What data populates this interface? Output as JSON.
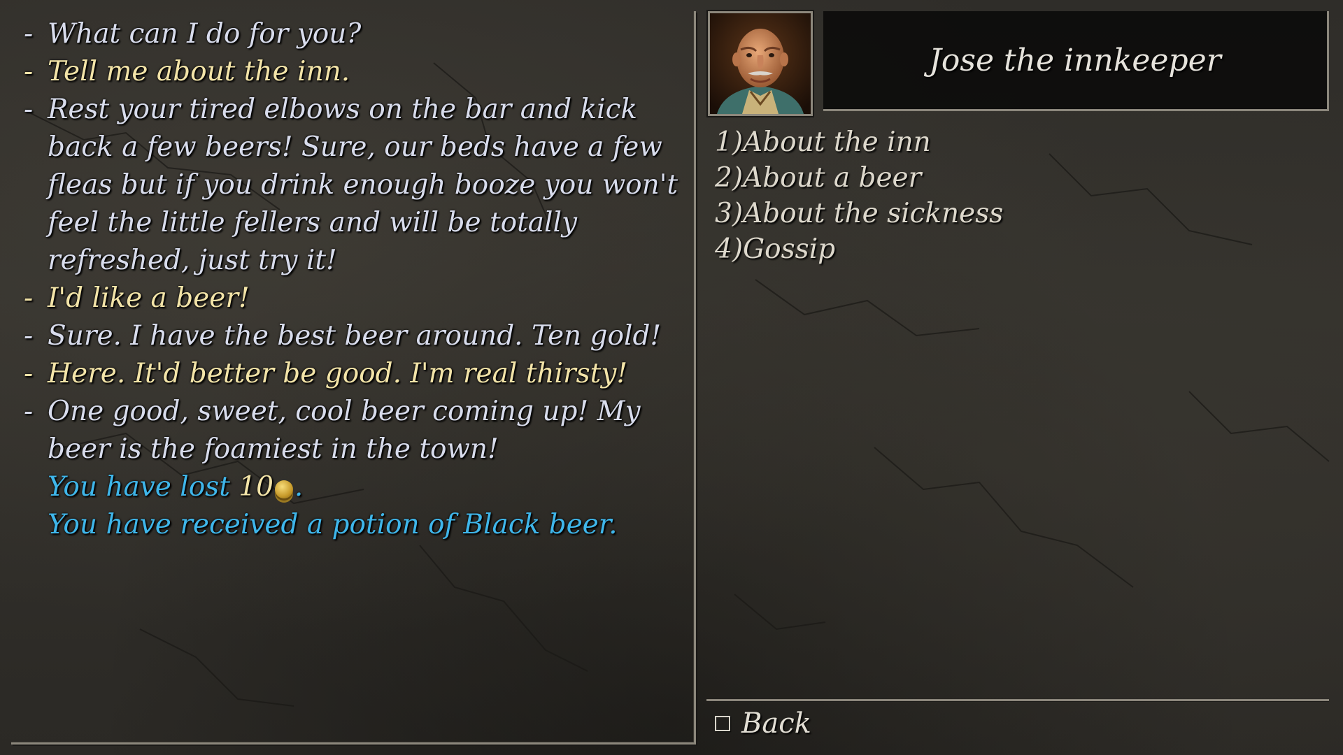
{
  "dialog_log": [
    {
      "speaker": "npc",
      "dash": "-",
      "text": "What can I do for you?"
    },
    {
      "speaker": "player",
      "dash": "-",
      "text": "Tell me about the inn."
    },
    {
      "speaker": "npc",
      "dash": "-",
      "text": "Rest your tired elbows on the bar and kick back a few beers! Sure, our beds have a few fleas but if you drink enough booze you won't feel the little fellers and will be totally refreshed, just try it!"
    },
    {
      "speaker": "player",
      "dash": "-",
      "text": "I'd like a beer!"
    },
    {
      "speaker": "npc",
      "dash": "-",
      "text": "Sure. I have the best beer around. Ten gold!"
    },
    {
      "speaker": "player",
      "dash": "-",
      "text": "Here. It'd better be good. I'm real thirsty!"
    },
    {
      "speaker": "npc",
      "dash": "-",
      "text": "One good, sweet, cool beer coming up! My beer is the foamiest in the town!"
    }
  ],
  "system_messages": {
    "lost_prefix": "You have lost ",
    "lost_amount": "10",
    "lost_suffix": ".",
    "received": "You have received a potion of Black beer."
  },
  "npc": {
    "name": "Jose the innkeeper",
    "portrait_icon": "innkeeper-portrait"
  },
  "options": [
    {
      "num": "1)",
      "label": "About the inn"
    },
    {
      "num": "2)",
      "label": "About a beer"
    },
    {
      "num": "3)",
      "label": "About the sickness"
    },
    {
      "num": "4)",
      "label": "Gossip"
    }
  ],
  "back": {
    "label": "Back",
    "icon": "checkbox-icon"
  },
  "colors": {
    "npc_text": "#d8dcec",
    "player_text": "#f3e4a8",
    "system_text": "#3fb6ea",
    "frame": "#8c877c"
  }
}
